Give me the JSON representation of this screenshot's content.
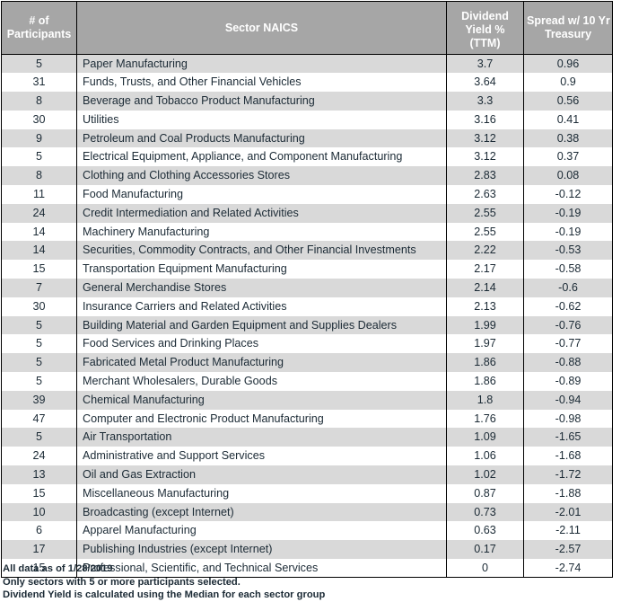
{
  "table": {
    "columns": [
      {
        "key": "participants",
        "header_lines": [
          "# of",
          "Participants"
        ],
        "align": "center"
      },
      {
        "key": "sector",
        "header_lines": [
          "Sector NAICS"
        ],
        "align": "left"
      },
      {
        "key": "yield",
        "header_lines": [
          "Dividend",
          "Yield %",
          "(TTM)"
        ],
        "align": "center"
      },
      {
        "key": "spread",
        "header_lines": [
          "Spread w/ 10 Yr",
          "Treasury"
        ],
        "align": "center"
      }
    ],
    "header": {
      "participants_line1": "# of",
      "participants_line2": "Participants",
      "sector": "Sector NAICS",
      "yield_line1": "Dividend",
      "yield_line2": "Yield %",
      "yield_line3": "(TTM)",
      "spread_line1": "Spread w/ 10 Yr",
      "spread_line2": "Treasury"
    },
    "rows": [
      {
        "participants": "5",
        "sector": "Paper Manufacturing",
        "yield": "3.7",
        "spread": "0.96"
      },
      {
        "participants": "31",
        "sector": "Funds, Trusts, and Other Financial Vehicles",
        "yield": "3.64",
        "spread": "0.9"
      },
      {
        "participants": "8",
        "sector": "Beverage and Tobacco Product Manufacturing",
        "yield": "3.3",
        "spread": "0.56"
      },
      {
        "participants": "30",
        "sector": "Utilities",
        "yield": "3.16",
        "spread": "0.41"
      },
      {
        "participants": "9",
        "sector": "Petroleum and Coal Products Manufacturing",
        "yield": "3.12",
        "spread": "0.38"
      },
      {
        "participants": "5",
        "sector": "Electrical Equipment, Appliance, and Component Manufacturing",
        "yield": "3.12",
        "spread": "0.37"
      },
      {
        "participants": "8",
        "sector": "Clothing and Clothing Accessories Stores",
        "yield": "2.83",
        "spread": "0.08"
      },
      {
        "participants": "11",
        "sector": "Food Manufacturing",
        "yield": "2.63",
        "spread": "-0.12"
      },
      {
        "participants": "24",
        "sector": "Credit Intermediation and Related Activities",
        "yield": "2.55",
        "spread": "-0.19"
      },
      {
        "participants": "14",
        "sector": "Machinery Manufacturing",
        "yield": "2.55",
        "spread": "-0.19"
      },
      {
        "participants": "14",
        "sector": "Securities, Commodity Contracts, and Other Financial Investments",
        "yield": "2.22",
        "spread": "-0.53"
      },
      {
        "participants": "15",
        "sector": "Transportation Equipment Manufacturing",
        "yield": "2.17",
        "spread": "-0.58"
      },
      {
        "participants": "7",
        "sector": "General Merchandise Stores",
        "yield": "2.14",
        "spread": "-0.6"
      },
      {
        "participants": "30",
        "sector": "Insurance Carriers and Related Activities",
        "yield": "2.13",
        "spread": "-0.62"
      },
      {
        "participants": "5",
        "sector": "Building Material and Garden Equipment and Supplies Dealers",
        "yield": "1.99",
        "spread": "-0.76"
      },
      {
        "participants": "5",
        "sector": "Food Services and Drinking Places",
        "yield": "1.97",
        "spread": "-0.77"
      },
      {
        "participants": "5",
        "sector": "Fabricated Metal Product Manufacturing",
        "yield": "1.86",
        "spread": "-0.88"
      },
      {
        "participants": "5",
        "sector": "Merchant Wholesalers, Durable Goods",
        "yield": "1.86",
        "spread": "-0.89"
      },
      {
        "participants": "39",
        "sector": "Chemical Manufacturing",
        "yield": "1.8",
        "spread": "-0.94"
      },
      {
        "participants": "47",
        "sector": "Computer and Electronic Product Manufacturing",
        "yield": "1.76",
        "spread": "-0.98"
      },
      {
        "participants": "5",
        "sector": "Air Transportation",
        "yield": "1.09",
        "spread": "-1.65"
      },
      {
        "participants": "24",
        "sector": "Administrative and Support Services",
        "yield": "1.06",
        "spread": "-1.68"
      },
      {
        "participants": "13",
        "sector": "Oil and Gas Extraction",
        "yield": "1.02",
        "spread": "-1.72"
      },
      {
        "participants": "15",
        "sector": "Miscellaneous Manufacturing",
        "yield": "0.87",
        "spread": "-1.88"
      },
      {
        "participants": "10",
        "sector": "Broadcasting (except Internet)",
        "yield": "0.73",
        "spread": "-2.01"
      },
      {
        "participants": "6",
        "sector": "Apparel Manufacturing",
        "yield": "0.63",
        "spread": "-2.11"
      },
      {
        "participants": "17",
        "sector": "Publishing Industries (except Internet)",
        "yield": "0.17",
        "spread": "-2.57"
      },
      {
        "participants": "15",
        "sector": "Professional, Scientific, and Technical Services",
        "yield": "0",
        "spread": "-2.74"
      }
    ]
  },
  "footnotes": [
    "All data as of 1/28/2019",
    "Only sectors with 5 or more participants selected.",
    "Dividend Yield is calculated using the Median for each sector group"
  ],
  "colors": {
    "header_background": "#a6a6a6",
    "header_text": "#ffffff",
    "row_alt_background": "#d9d9d9",
    "row_base_background": "#ffffff",
    "body_text": "#1b2a35",
    "border": "#000000"
  }
}
